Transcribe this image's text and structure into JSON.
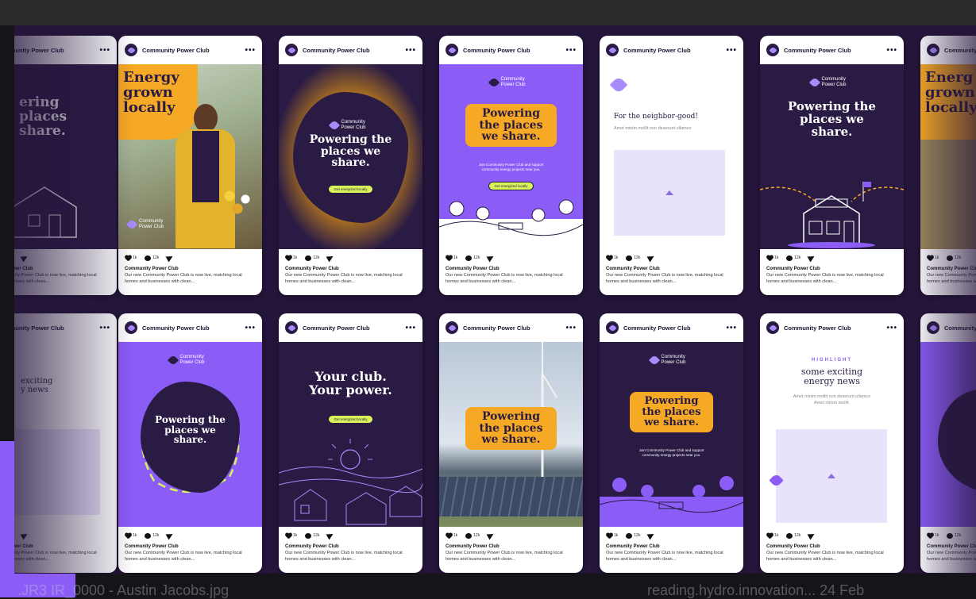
{
  "account_name": "Community Power Club",
  "caption_text": "Our new Community Power Club is now live, matching local homes and businesses with clean...",
  "likes": "1k",
  "comments": "12k",
  "brand": {
    "purple": "#8b5cf6",
    "dark": "#2a1b44",
    "orange": "#f6a924",
    "lime": "#d9f35b"
  },
  "logo_text": "Community Power Club",
  "headlines": {
    "energy_grown": "Energy grown locally",
    "powering": "Powering the places we share.",
    "neighbor": "For the neighbor-good!",
    "your_club": "Your club. Your power.",
    "highlight_label": "HIGHLIGHT",
    "exciting": "some exciting energy news"
  },
  "body_texts": {
    "lorem": "Amet minim mollit non deserunt ullamco",
    "lorem2": "Amet minim mollit non deserunt ullamco Amet minim mollit.",
    "join": "Join Community Power Club and support community energy projects near you."
  },
  "cta": "Get energized locally",
  "partial_cards": {
    "left_row1": [
      "ering",
      "places",
      "share."
    ],
    "left_row2": [
      "exciting",
      "y news"
    ],
    "right_row1": [
      "Energ",
      "grown",
      "locally"
    ]
  },
  "file_labels": {
    "left": ".JR3 IR_0000 - Austin Jacobs.jpg",
    "right": "reading.hydro.innovation... 24 Feb"
  }
}
